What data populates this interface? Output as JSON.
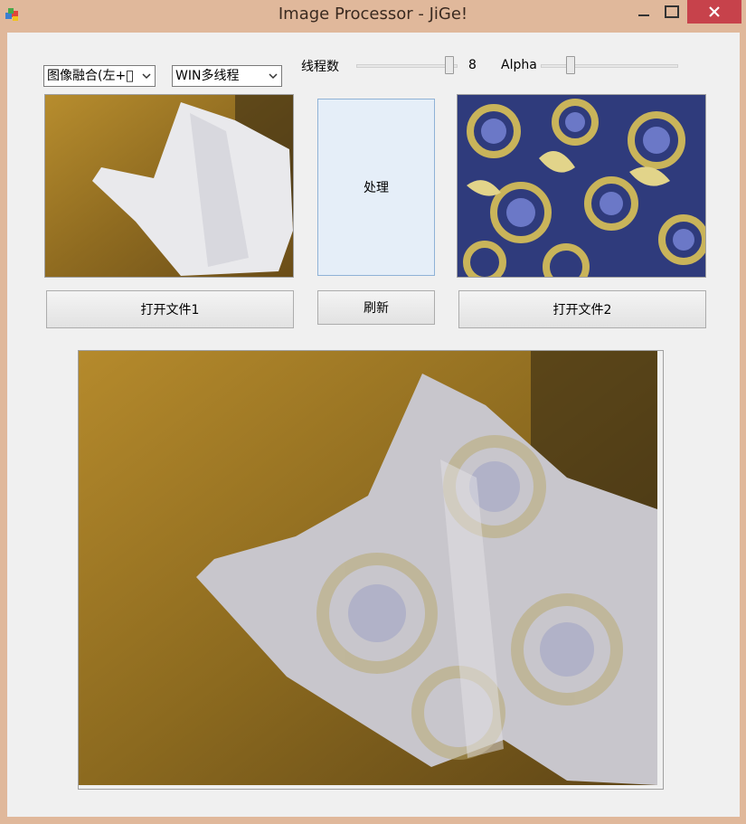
{
  "window": {
    "title": "Image Processor - JiGe!",
    "icons": [
      "app-icon",
      "minimize-icon",
      "maximize-icon",
      "close-icon"
    ]
  },
  "controls": {
    "mode_select": {
      "value": "图像融合(左+ᷓ"
    },
    "thread_select": {
      "value": "WIN多线程"
    },
    "threads_label": "线程数",
    "threads_value": "8",
    "threads_level_fraction": 0.96,
    "alpha_label": "Alpha",
    "alpha_level_fraction": 0.2
  },
  "buttons": {
    "process": "处理",
    "refresh": "刷新",
    "open_file1": "打开文件1",
    "open_file2": "打开文件2"
  },
  "colors": {
    "close_button": "#c7424b",
    "title_bar": "#e0b89b",
    "client": "#f0f0f0",
    "process_button": "#e5eef8"
  }
}
